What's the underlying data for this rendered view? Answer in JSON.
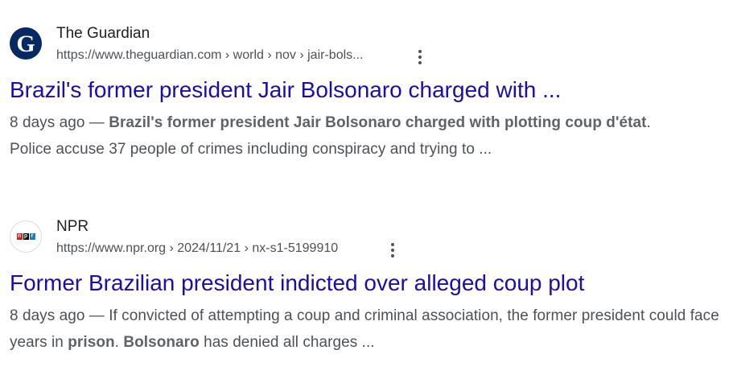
{
  "results": [
    {
      "site_name": "The Guardian",
      "url": "https://www.theguardian.com › world › nov › jair-bols...",
      "favicon_icon": "guardian-logo-icon",
      "favicon_letter": "G",
      "brand_color": "#052962",
      "title": "Brazil's former president Jair Bolsonaro charged with ...",
      "snippet_date": "8 days ago —",
      "snippet_bold1": "Brazil's former president Jair Bolsonaro charged with plotting coup d'état",
      "snippet_rest1": ".",
      "snippet_line2": "Police accuse 37 people of crimes including conspiracy and trying to ..."
    },
    {
      "site_name": "NPR",
      "url": "https://www.npr.org › 2024/11/21 › nx-s1-5199910",
      "favicon_icon": "npr-logo-icon",
      "favicon_letters": [
        "n",
        "p",
        "r"
      ],
      "brand_colors": [
        "#d62021",
        "#000000",
        "#237bbd"
      ],
      "title": "Former Brazilian president indicted over alleged coup plot",
      "snippet_date": "8 days ago —",
      "snippet_text1": "If convicted of attempting a coup and criminal association, the former president could face years in",
      "snippet_bold1": "prison",
      "snippet_text2": ".",
      "snippet_bold2": "Bolsonaro",
      "snippet_text3": "has denied all charges ..."
    }
  ],
  "colors": {
    "link": "#1a0dab",
    "text": "#202124",
    "muted": "#4d5156"
  }
}
